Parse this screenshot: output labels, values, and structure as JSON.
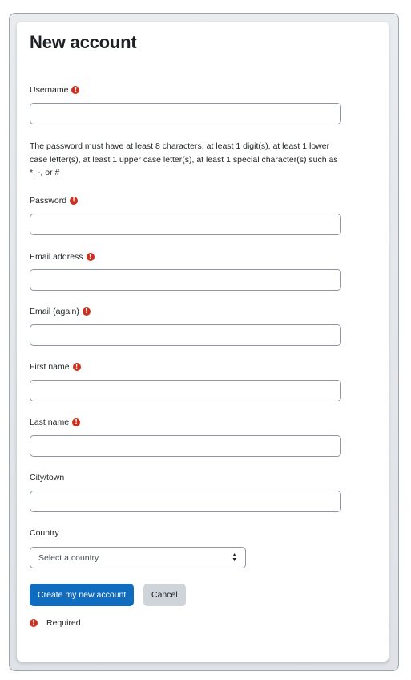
{
  "page": {
    "title": "New account"
  },
  "form": {
    "required_icon": "exclamation-circle-icon",
    "fields": {
      "username": {
        "label": "Username",
        "value": "",
        "required": true
      },
      "password_policy": "The password must have at least 8 characters, at least 1 digit(s), at least 1 lower case letter(s), at least 1 upper case letter(s), at least 1 special character(s) such as *, -, or #",
      "password": {
        "label": "Password",
        "value": "",
        "required": true
      },
      "email": {
        "label": "Email address",
        "value": "",
        "required": true
      },
      "email2": {
        "label": "Email (again)",
        "value": "",
        "required": true
      },
      "firstname": {
        "label": "First name",
        "value": "",
        "required": true
      },
      "lastname": {
        "label": "Last name",
        "value": "",
        "required": true
      },
      "city": {
        "label": "City/town",
        "value": "",
        "required": false
      },
      "country": {
        "label": "Country",
        "selected": "Select a country",
        "required": false
      }
    },
    "buttons": {
      "submit": "Create my new account",
      "cancel": "Cancel"
    },
    "legend": {
      "icon_glyph": "!",
      "text": "Required"
    }
  },
  "colors": {
    "primary": "#0f6cbf",
    "secondary": "#ced4da",
    "required": "#ca3120"
  }
}
